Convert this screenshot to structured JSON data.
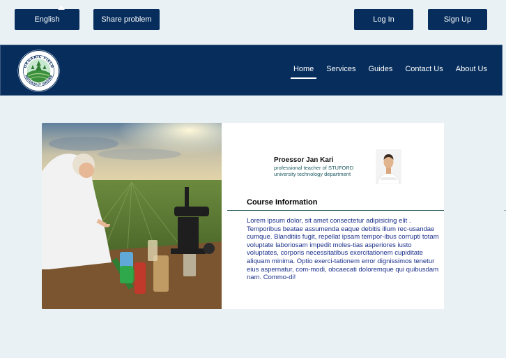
{
  "top_buttons": {
    "language": "English",
    "share": "Share problem",
    "login": "Log In",
    "signup": "Sign Up"
  },
  "logo": {
    "top_text": "ORGANIC FIELD",
    "bottom_text": "NATURALLY GROWN"
  },
  "nav": {
    "items": [
      {
        "label": "Home",
        "active": true
      },
      {
        "label": "Services"
      },
      {
        "label": "Guides"
      },
      {
        "label": "Contact Us"
      },
      {
        "label": "About Us"
      }
    ]
  },
  "teacher": {
    "name": "Proessor Jan Kari",
    "subtitle": "professional teacher of STUFORD university technology department"
  },
  "course": {
    "title": "Course Information",
    "body": "Lorem ipsum dolor, sit amet consectetur adipisicing elit . Temporibus beatae assumenda eaque debitis illum rec-usandae cumque. Blanditiis fugit, repellat ipsam tempor-ibus corrupti totam voluptate laboriosam impedit moles-tias asperiores iusto voluptates, corporis necessitatibus exercitationem cupiditate aliquam minima. Optio exerci-tationem error dignissimos tenetur eius aspernatur, com-modi, obcaecati doloremque qui quibusdam nam. Commo-di!"
  },
  "colors": {
    "navy": "#062d5c",
    "background": "#eaf1f5",
    "body_text": "#1a2f8a"
  }
}
